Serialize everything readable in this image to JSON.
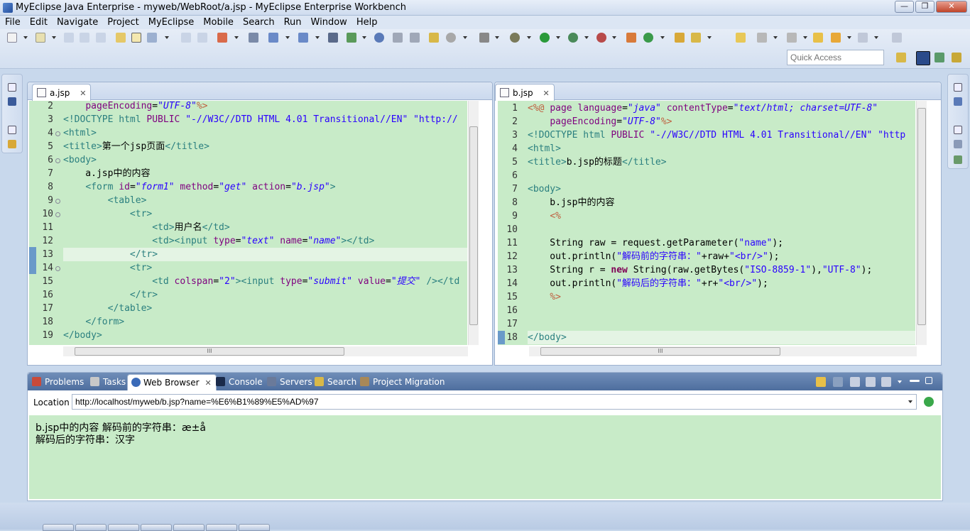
{
  "window": {
    "title": "MyEclipse Java Enterprise - myweb/WebRoot/a.jsp - MyEclipse Enterprise Workbench",
    "minimize": "—",
    "maximize": "❐",
    "close": "✕"
  },
  "menu": [
    "File",
    "Edit",
    "Navigate",
    "Project",
    "MyEclipse",
    "Mobile",
    "Search",
    "Run",
    "Window",
    "Help"
  ],
  "toolbar": {
    "quick_access_placeholder": "Quick Access"
  },
  "editor_left": {
    "tab": "a.jsp",
    "close": "✕",
    "line_numbers": [
      "2",
      "3",
      "4",
      "5",
      "6",
      "7",
      "8",
      "9",
      "10",
      "11",
      "12",
      "13",
      "14",
      "15",
      "16",
      "17",
      "18",
      "19"
    ],
    "hscroll_grip": "III"
  },
  "editor_right": {
    "tab": "b.jsp",
    "close": "✕",
    "line_numbers": [
      "1",
      "2",
      "3",
      "4",
      "5",
      "6",
      "7",
      "8",
      "9",
      "10",
      "11",
      "12",
      "13",
      "14",
      "15",
      "16",
      "17",
      "18"
    ],
    "hscroll_grip": "III"
  },
  "bottom_panel": {
    "tabs": [
      "Problems",
      "Tasks",
      "Web Browser",
      "Console",
      "Servers",
      "Search",
      "Project Migration"
    ],
    "active_tab_close": "✕",
    "location_label": "Location",
    "location_value": "http://localhost/myweb/b.jsp?name=%E6%B1%89%E5%AD%97",
    "content_line1": "b.jsp中的内容 解码前的字符串：æ±å",
    "content_line2": "解码后的字符串：汉字"
  },
  "colors": {
    "code_bg": "#c8ebc8",
    "tag": "#2a7f7f",
    "attr": "#7f007f",
    "value": "#2a00ff",
    "directive": "#bf5f3f",
    "keyword": "#7f0055",
    "panel_header": "#5a7aab"
  }
}
